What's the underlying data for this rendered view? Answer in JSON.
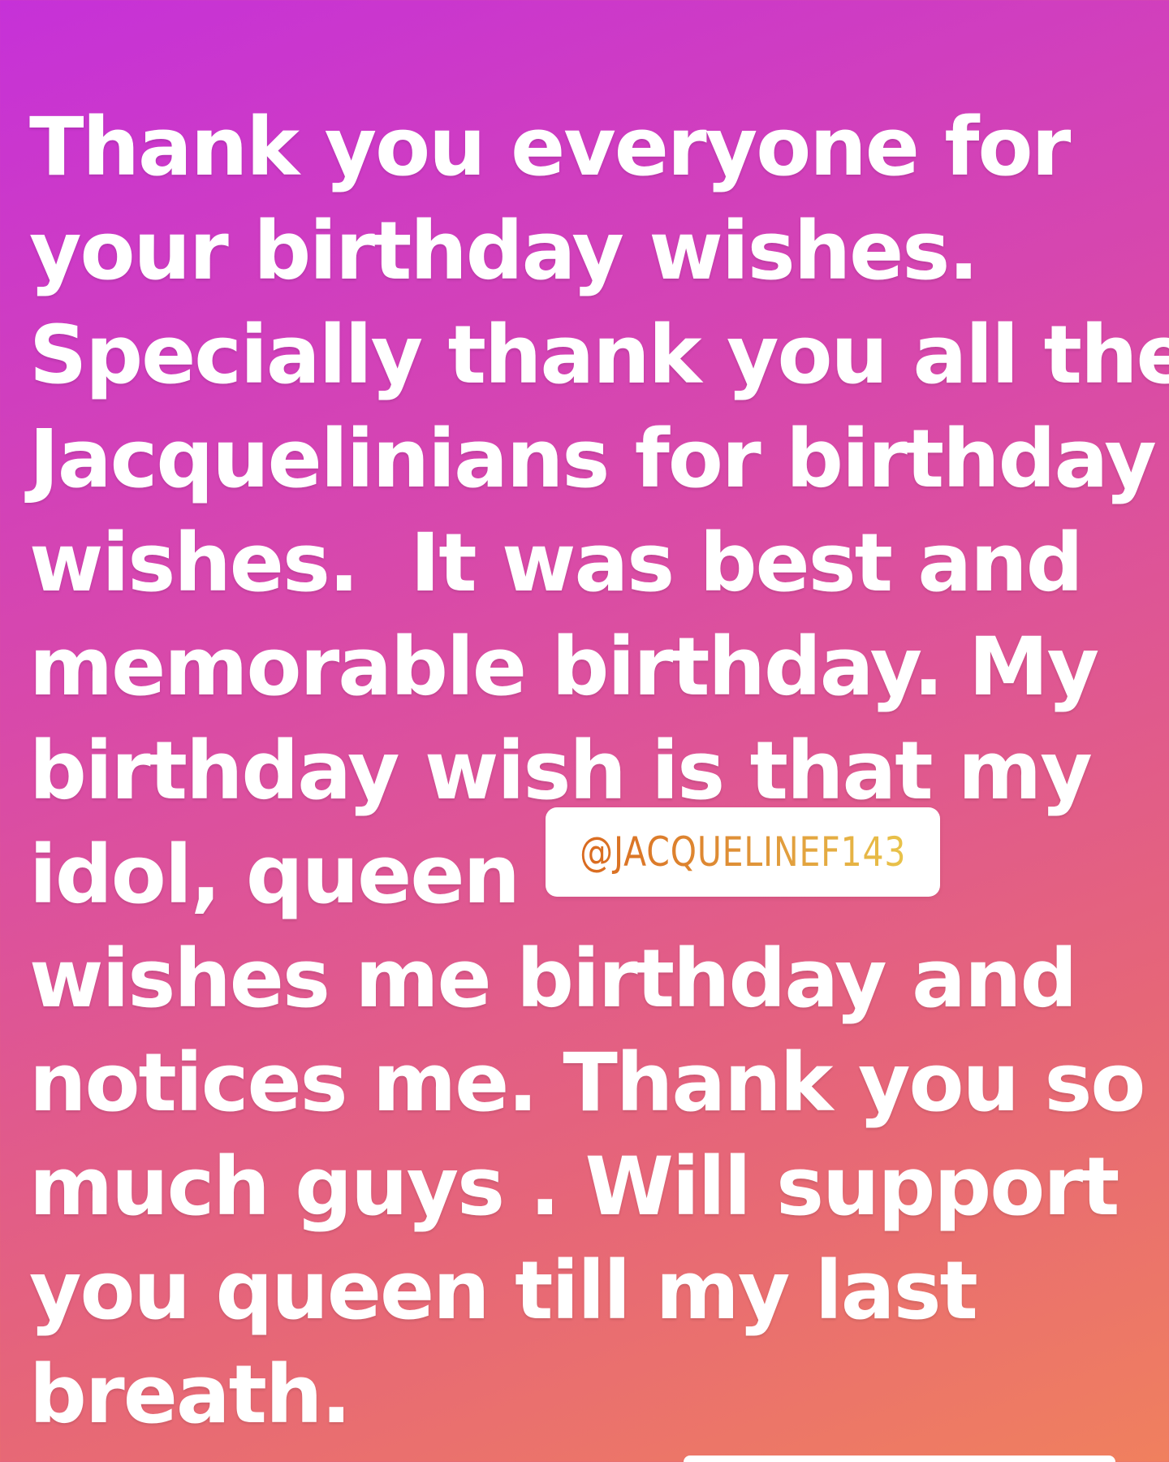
{
  "story": {
    "message": "Thank you everyone for\nyour birthday wishes.\nSpecially thank you all the\nJacquelinians for birthday\nwishes.  It was best and\nmemorable birthday. My\nbirthday wish is that my\nidol, queen\nwishes me birthday and\nnotices me. Thank you so\nmuch guys . Will support\nyou queen till my last\nbreath.",
    "mention": "@JACQUELINEF143"
  }
}
